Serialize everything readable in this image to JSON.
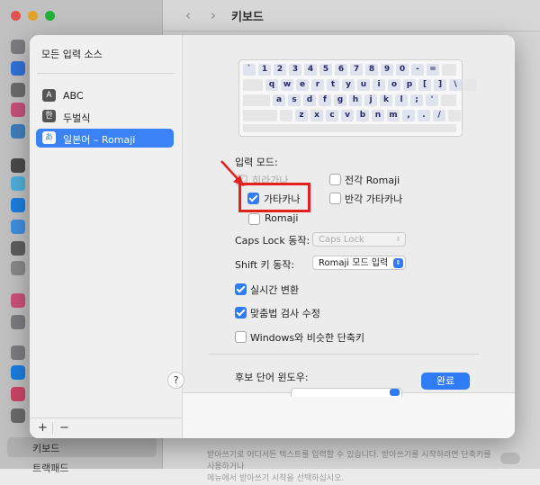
{
  "window": {
    "title": "키보드",
    "sidebar_selected": "키보드",
    "sidebar_next": "트랙패드",
    "footnote_line1": "받아쓰기로 어디서든 텍스트를 입력할 수 있습니다. 받아쓰기를 시작하려면 단축키를 사용하거나",
    "footnote_line2": "메뉴에서 받아쓰기 시작을 선택하십시오."
  },
  "sheet": {
    "sources_title": "모든 입력 소스",
    "sources": [
      {
        "badge": "A",
        "label": "ABC",
        "selected": false
      },
      {
        "badge": "한",
        "label": "두벌식",
        "selected": false
      },
      {
        "badge": "あ",
        "label": "일본어 – Romaji",
        "selected": true
      }
    ],
    "footer": {
      "add": "+",
      "remove": "−"
    },
    "keyboard_rows": [
      [
        "`",
        "1",
        "2",
        "3",
        "4",
        "5",
        "6",
        "7",
        "8",
        "9",
        "0",
        "-",
        "="
      ],
      [
        "q",
        "w",
        "e",
        "r",
        "t",
        "y",
        "u",
        "i",
        "o",
        "p",
        "[",
        "]",
        "\\"
      ],
      [
        "a",
        "s",
        "d",
        "f",
        "g",
        "h",
        "j",
        "k",
        "l",
        ";",
        "'"
      ],
      [
        "z",
        "x",
        "c",
        "v",
        "b",
        "n",
        "m",
        ",",
        ".",
        "/"
      ]
    ],
    "input_mode_label": "입력 모드:",
    "modes": {
      "hiragana": {
        "label": "히라가나",
        "checked": true,
        "disabled": true
      },
      "katakana": {
        "label": "가타카나",
        "checked": true
      },
      "romaji": {
        "label": "Romaji",
        "checked": false
      },
      "fullwidth_romaji": {
        "label": "전각 Romaji",
        "checked": false
      },
      "halfwidth_katakana": {
        "label": "반각 가타카나",
        "checked": false
      }
    },
    "caps_lock_label": "Caps Lock 동작:",
    "caps_lock_value": "Caps Lock",
    "shift_label": "Shift 키 동작:",
    "shift_value": "Romaji 모드 입력",
    "options": {
      "live_conversion": {
        "label": "실시간 변환",
        "checked": true
      },
      "spell_check": {
        "label": "맞춤법 검사 수정",
        "checked": true
      },
      "windows_shortcuts": {
        "label": "Windows와 비슷한 단축키",
        "checked": false
      }
    },
    "candidate_window_label": "후보 단어 윈도우:",
    "help": "?",
    "done": "완료"
  },
  "colors": {
    "accent": "#2f7cf6",
    "highlight": "#e3201d"
  },
  "icons": {
    "back": "chevron-left-icon",
    "forward": "chevron-right-icon",
    "arrow": "red-arrow-icon"
  }
}
